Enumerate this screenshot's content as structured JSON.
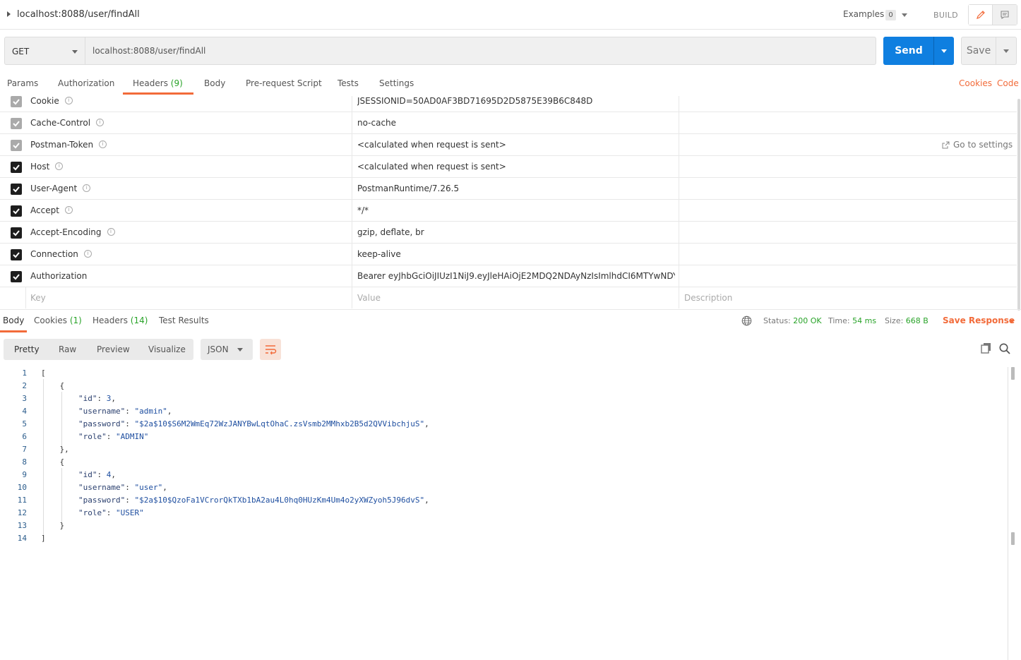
{
  "title_bar": {
    "request_name": "localhost:8088/user/findAll",
    "examples_label": "Examples",
    "examples_count": "0",
    "build_label": "BUILD"
  },
  "url_bar": {
    "method": "GET",
    "url": "localhost:8088/user/findAll",
    "send_label": "Send",
    "save_label": "Save"
  },
  "request_tabs": {
    "items": [
      {
        "label": "Params"
      },
      {
        "label": "Authorization"
      },
      {
        "label": "Headers",
        "count": "(9)"
      },
      {
        "label": "Body"
      },
      {
        "label": "Pre-request Script"
      },
      {
        "label": "Tests"
      },
      {
        "label": "Settings"
      }
    ],
    "active": "Headers",
    "cookies_link": "Cookies",
    "code_link": "Code"
  },
  "headers": {
    "go_to_settings": "Go to settings",
    "rows": [
      {
        "key": "Cookie",
        "value": "JSESSIONID=50AD0AF3BD71695D2D5875E39B6C848D",
        "checked": true,
        "auto": true,
        "info": true
      },
      {
        "key": "Cache-Control",
        "value": "no-cache",
        "checked": true,
        "auto": true,
        "info": true
      },
      {
        "key": "Postman-Token",
        "value": "<calculated when request is sent>",
        "checked": true,
        "auto": true,
        "info": true
      },
      {
        "key": "Host",
        "value": "<calculated when request is sent>",
        "checked": true,
        "auto": false,
        "info": true
      },
      {
        "key": "User-Agent",
        "value": "PostmanRuntime/7.26.5",
        "checked": true,
        "auto": false,
        "info": true
      },
      {
        "key": "Accept",
        "value": "*/*",
        "checked": true,
        "auto": false,
        "info": true
      },
      {
        "key": "Accept-Encoding",
        "value": "gzip, deflate, br",
        "checked": true,
        "auto": false,
        "info": true
      },
      {
        "key": "Connection",
        "value": "keep-alive",
        "checked": true,
        "auto": false,
        "info": true
      },
      {
        "key": "Authorization",
        "value": "Bearer eyJhbGciOiJIUzI1NiJ9.eyJleHAiOjE2MDQ2NDAyNzIsImlhdCI6MTYwNDY0 ...",
        "checked": true,
        "auto": false,
        "info": false
      }
    ],
    "placeholder": {
      "key": "Key",
      "value": "Value",
      "description": "Description"
    }
  },
  "response_tabs": {
    "items": [
      {
        "label": "Body"
      },
      {
        "label": "Cookies",
        "count": "(1)"
      },
      {
        "label": "Headers",
        "count": "(14)"
      },
      {
        "label": "Test Results"
      }
    ],
    "active": "Body",
    "status_label": "Status:",
    "status_value": "200 OK",
    "time_label": "Time:",
    "time_value": "54 ms",
    "size_label": "Size:",
    "size_value": "668 B",
    "save_response": "Save Response"
  },
  "response_toolbar": {
    "views": [
      "Pretty",
      "Raw",
      "Preview",
      "Visualize"
    ],
    "active_view": "Pretty",
    "format": "JSON"
  },
  "response_body": [
    {
      "n": "1",
      "text": "["
    },
    {
      "n": "2",
      "text": "    {"
    },
    {
      "n": "3",
      "text": "        \"id\": 3,"
    },
    {
      "n": "4",
      "text": "        \"username\": \"admin\","
    },
    {
      "n": "5",
      "text": "        \"password\": \"$2a$10$S6M2WmEq72WzJANYBwLqtOhaC.zsVsmb2MMhxb2B5d2QVVibchjuS\","
    },
    {
      "n": "6",
      "text": "        \"role\": \"ADMIN\""
    },
    {
      "n": "7",
      "text": "    },"
    },
    {
      "n": "8",
      "text": "    {"
    },
    {
      "n": "9",
      "text": "        \"id\": 4,"
    },
    {
      "n": "10",
      "text": "        \"username\": \"user\","
    },
    {
      "n": "11",
      "text": "        \"password\": \"$2a$10$QzoFa1VCrorQkTXb1bA2au4L0hq0HUzKm4Um4o2yXWZyoh5J96dvS\","
    },
    {
      "n": "12",
      "text": "        \"role\": \"USER\""
    },
    {
      "n": "13",
      "text": "    }"
    },
    {
      "n": "14",
      "text": "]"
    }
  ],
  "colors": {
    "accent": "#f26b3a",
    "send": "#0f7fe0",
    "ok": "#29a329"
  }
}
